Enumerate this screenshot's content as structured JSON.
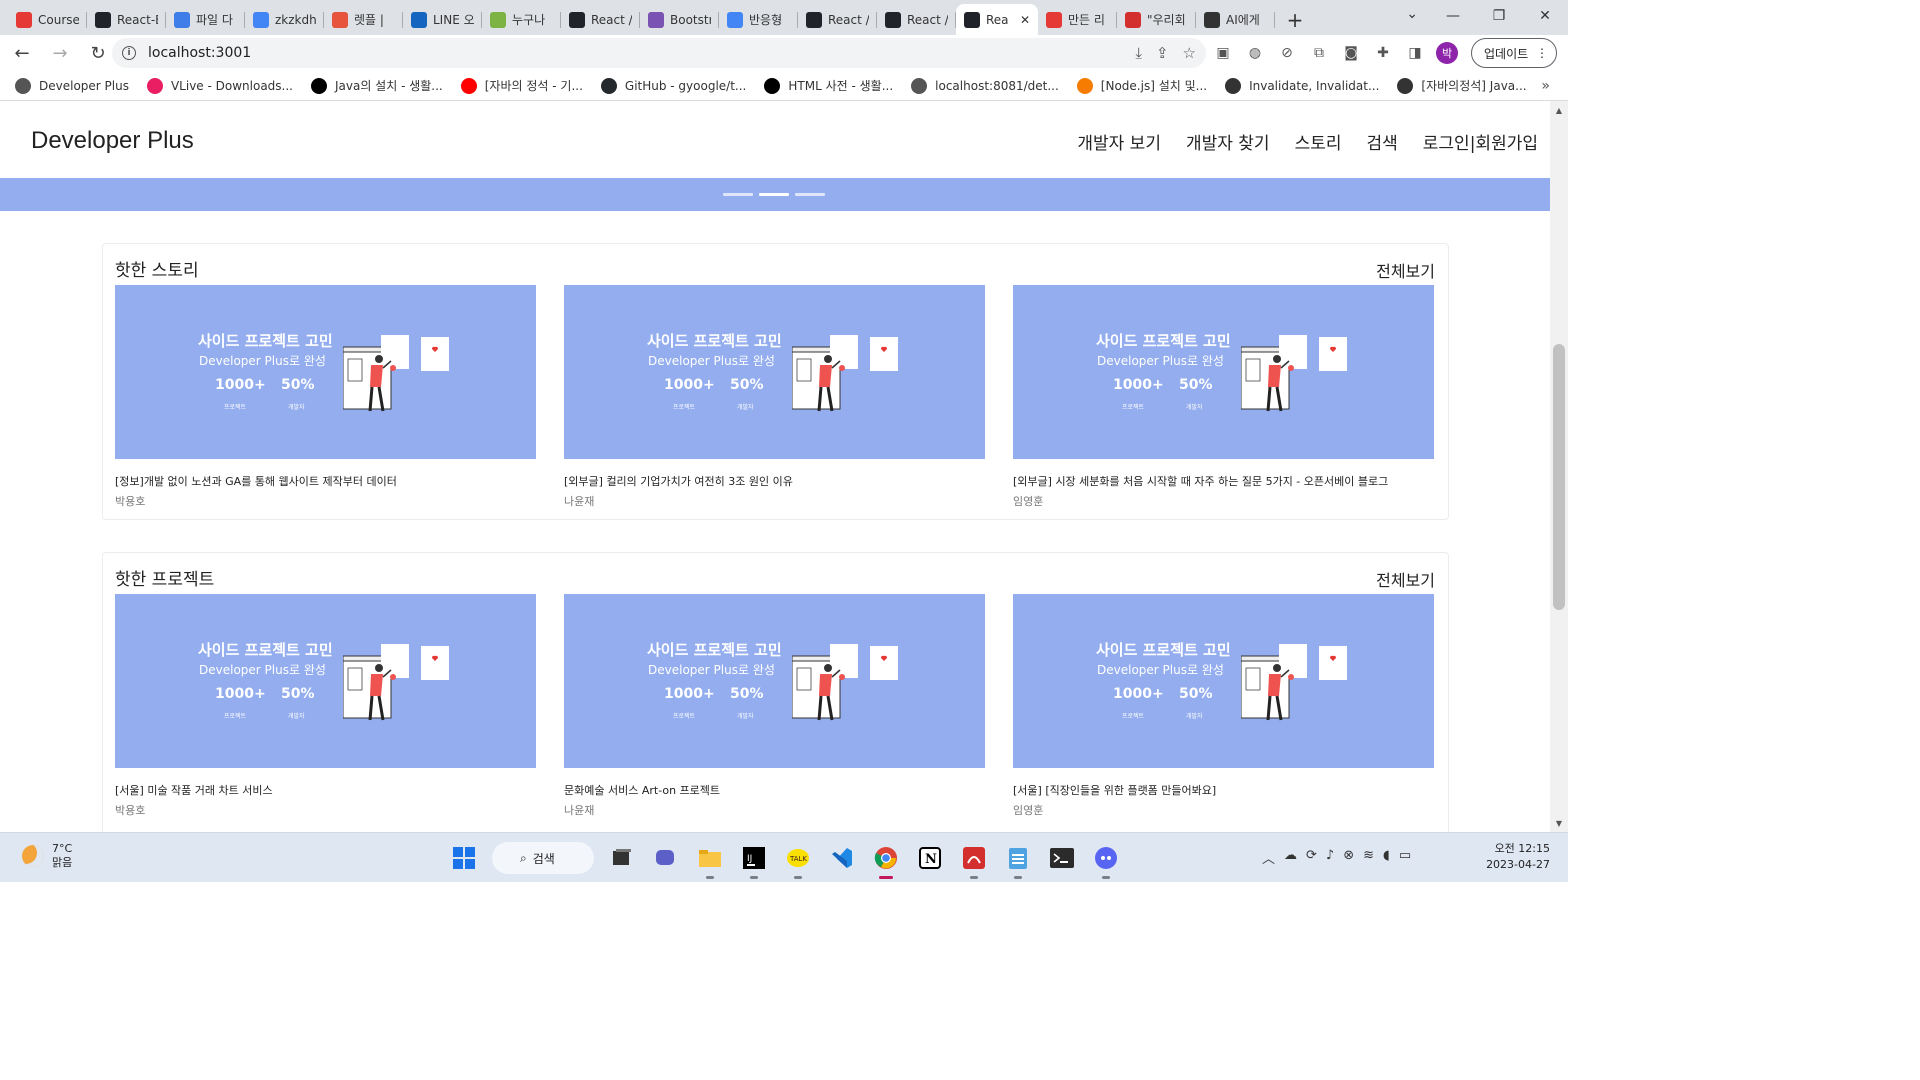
{
  "tabs": [
    {
      "label": "Course",
      "icon": "tomato-icon",
      "color": "#e53935"
    },
    {
      "label": "React-E",
      "icon": "react-icon",
      "color": "#20232a"
    },
    {
      "label": "파일 다",
      "icon": "heart-icon",
      "color": "#3f7de8"
    },
    {
      "label": "zkzkdh",
      "icon": "google-icon",
      "color": "#4285f4"
    },
    {
      "label": "렛플 |",
      "icon": "let-icon",
      "color": "#e8553d"
    },
    {
      "label": "LINE 오",
      "icon": "line-icon",
      "color": "#1565c0"
    },
    {
      "label": "누구나",
      "icon": "page-icon",
      "color": "#7cb342"
    },
    {
      "label": "React /",
      "icon": "react-icon",
      "color": "#20232a"
    },
    {
      "label": "Bootstr",
      "icon": "bootstrap-icon",
      "color": "#7952b3"
    },
    {
      "label": "반응형",
      "icon": "google-icon",
      "color": "#4285f4"
    },
    {
      "label": "React /",
      "icon": "react-icon",
      "color": "#20232a"
    },
    {
      "label": "React /",
      "icon": "react-icon",
      "color": "#20232a"
    },
    {
      "label": "Rea",
      "icon": "react-icon",
      "color": "#20232a",
      "active": true
    },
    {
      "label": "만든 리",
      "icon": "tomato-icon",
      "color": "#e53935"
    },
    {
      "label": "\"우리회",
      "icon": "c-icon",
      "color": "#d32f2f"
    },
    {
      "label": "AI에게",
      "icon": "slash-icon",
      "color": "#333333"
    }
  ],
  "address": {
    "url": "localhost:3001",
    "update_label": "업데이트",
    "avatar_label": "박"
  },
  "bookmarks": [
    {
      "label": "Developer Plus",
      "color": "#555555"
    },
    {
      "label": "VLive - Downloads...",
      "color": "#e91e63"
    },
    {
      "label": "Java의 설치 - 생활...",
      "color": "#000000"
    },
    {
      "label": "[자바의 정석 - 기...",
      "color": "#ff0000"
    },
    {
      "label": "GitHub - gyoogle/t...",
      "color": "#24292e"
    },
    {
      "label": "HTML 사전 - 생활...",
      "color": "#000000"
    },
    {
      "label": "localhost:8081/det...",
      "color": "#555555"
    },
    {
      "label": "[Node.js] 설치 및...",
      "color": "#f57c00"
    },
    {
      "label": "Invalidate, Invalidat...",
      "color": "#333333"
    },
    {
      "label": "[자바의정석] Java...",
      "color": "#333333"
    }
  ],
  "site": {
    "logo": "Developer Plus",
    "nav": [
      "개발자 보기",
      "개발자 찾기",
      "스토리",
      "검색",
      "로그인|회원가입"
    ]
  },
  "thumbnail": {
    "title": "사이드 프로젝트 고민",
    "subtitle": "Developer Plus로 완성",
    "stat1_value": "1000+",
    "stat1_label": "프로젝트",
    "stat2_value": "50%",
    "stat2_label": "개발자",
    "bg_color": "#93adee"
  },
  "sections": [
    {
      "title": "핫한 스토리",
      "see_all": "전체보기",
      "cards": [
        {
          "title": "[정보]개발 없이 노션과 GA를 통해 웹사이트 제작부터 데이터",
          "author": "박용호"
        },
        {
          "title": "[외부글] 컬리의 기업가치가 여전히 3조 원인 이유",
          "author": "나윤재"
        },
        {
          "title": "[외부글] 시장 세분화를 처음 시작할 때 자주 하는 질문 5가지 - 오픈서베이 블로그",
          "author": "임영훈"
        }
      ]
    },
    {
      "title": "핫한 프로젝트",
      "see_all": "전체보기",
      "cards": [
        {
          "title": "[서울] 미술 작품 거래 차트 서비스",
          "author": "박용호"
        },
        {
          "title": "문화예술 서비스 Art-on 프로젝트",
          "author": "나윤재"
        },
        {
          "title": "[서울] [직장인들을 위한 플랫폼 만들어봐요]",
          "author": "임영훈"
        }
      ]
    }
  ],
  "taskbar": {
    "temperature": "7°C",
    "weather": "맑음",
    "search_label": "검색",
    "time": "오전 12:15",
    "date": "2023-04-27"
  },
  "colors": {
    "banner": "#93adee",
    "accent_focus": "#c2185b"
  }
}
